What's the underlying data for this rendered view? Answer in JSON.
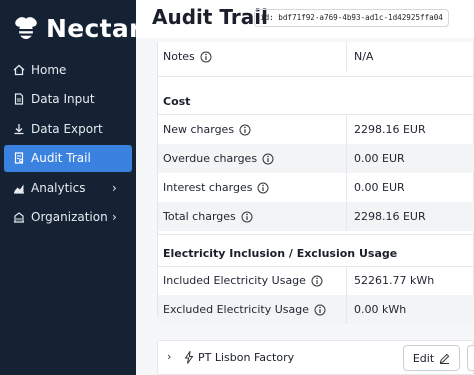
{
  "app": {
    "name": "Nectar"
  },
  "sidebar": {
    "items": [
      {
        "label": "Home",
        "icon": "home-icon",
        "active": false,
        "expandable": false
      },
      {
        "label": "Data Input",
        "icon": "file-input-icon",
        "active": false,
        "expandable": false
      },
      {
        "label": "Data Export",
        "icon": "download-icon",
        "active": false,
        "expandable": false
      },
      {
        "label": "Audit Trail",
        "icon": "audit-icon",
        "active": true,
        "expandable": false
      },
      {
        "label": "Analytics",
        "icon": "chart-icon",
        "active": false,
        "expandable": true
      },
      {
        "label": "Organization",
        "icon": "building-icon",
        "active": false,
        "expandable": true
      }
    ]
  },
  "header": {
    "title": "Audit Trail",
    "record_id": "id: bdf71f92-a769-4b93-ad1c-1d42925ffa04"
  },
  "details": {
    "notes": {
      "label": "Notes",
      "value": "N/A"
    },
    "cost": {
      "heading": "Cost",
      "rows": [
        {
          "label": "New charges",
          "value": "2298.16 EUR"
        },
        {
          "label": "Overdue charges",
          "value": "0.00 EUR"
        },
        {
          "label": "Interest charges",
          "value": "0.00 EUR"
        },
        {
          "label": "Total charges",
          "value": "2298.16 EUR"
        }
      ]
    },
    "electricity": {
      "heading": "Electricity Inclusion / Exclusion Usage",
      "rows": [
        {
          "label": "Included Electricity Usage",
          "value": "52261.77 kWh"
        },
        {
          "label": "Excluded Electricity Usage",
          "value": "0.00 kWh"
        }
      ]
    }
  },
  "factory": {
    "name": "PT Lisbon Factory",
    "edit_label": "Edit"
  },
  "colors": {
    "sidebar_bg": "#152233",
    "accent": "#3b82e0"
  }
}
